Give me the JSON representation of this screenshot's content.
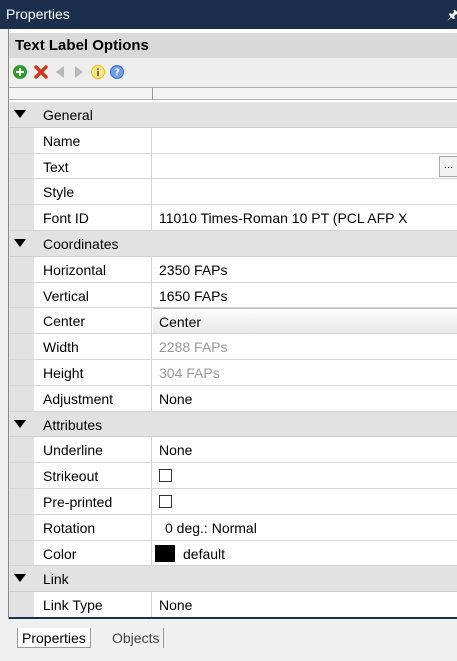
{
  "window": {
    "title": "Properties",
    "pin_glyph": "↕"
  },
  "panel": {
    "header": "Text Label Options"
  },
  "toolbar": {
    "icons": [
      "add-icon",
      "delete-icon",
      "move-left-icon",
      "move-right-icon",
      "info-icon",
      "help-icon"
    ],
    "colors": {
      "add": "#2e9d2e",
      "delete": "#d23a1d",
      "arrows": "#b8b8b8",
      "info": "#f5b800",
      "help": "#3a6fd8"
    }
  },
  "categories": {
    "general": {
      "label": "General",
      "props": {
        "name": {
          "label": "Name",
          "value": ""
        },
        "text": {
          "label": "Text",
          "value": "",
          "button": "..."
        },
        "style": {
          "label": "Style",
          "value": ""
        },
        "font_id": {
          "label": "Font ID",
          "value": "11010 Times-Roman 10 PT (PCL AFP X"
        }
      }
    },
    "coordinates": {
      "label": "Coordinates",
      "props": {
        "horizontal": {
          "label": "Horizontal",
          "value": "2350 FAPs"
        },
        "vertical": {
          "label": "Vertical",
          "value": "1650 FAPs"
        },
        "center": {
          "label": "Center",
          "value": "Center"
        },
        "width": {
          "label": "Width",
          "value": "2288 FAPs"
        },
        "height": {
          "label": "Height",
          "value": "304 FAPs"
        },
        "adjustment": {
          "label": "Adjustment",
          "value": "None"
        }
      }
    },
    "attributes": {
      "label": "Attributes",
      "props": {
        "underline": {
          "label": "Underline",
          "value": "None"
        },
        "strikeout": {
          "label": "Strikeout",
          "checked": false
        },
        "preprinted": {
          "label": "Pre-printed",
          "checked": false
        },
        "rotation": {
          "label": "Rotation",
          "value": "0 deg.: Normal"
        },
        "color": {
          "label": "Color",
          "value": "default",
          "swatch": "#000000"
        }
      }
    },
    "link": {
      "label": "Link",
      "props": {
        "link_type": {
          "label": "Link Type",
          "value": "None"
        }
      }
    }
  },
  "tabs": {
    "properties": "Properties",
    "objects": "Objects"
  },
  "colors": {
    "titlebar": "#1b2f4d",
    "category_bg": "#e2e2e2"
  }
}
